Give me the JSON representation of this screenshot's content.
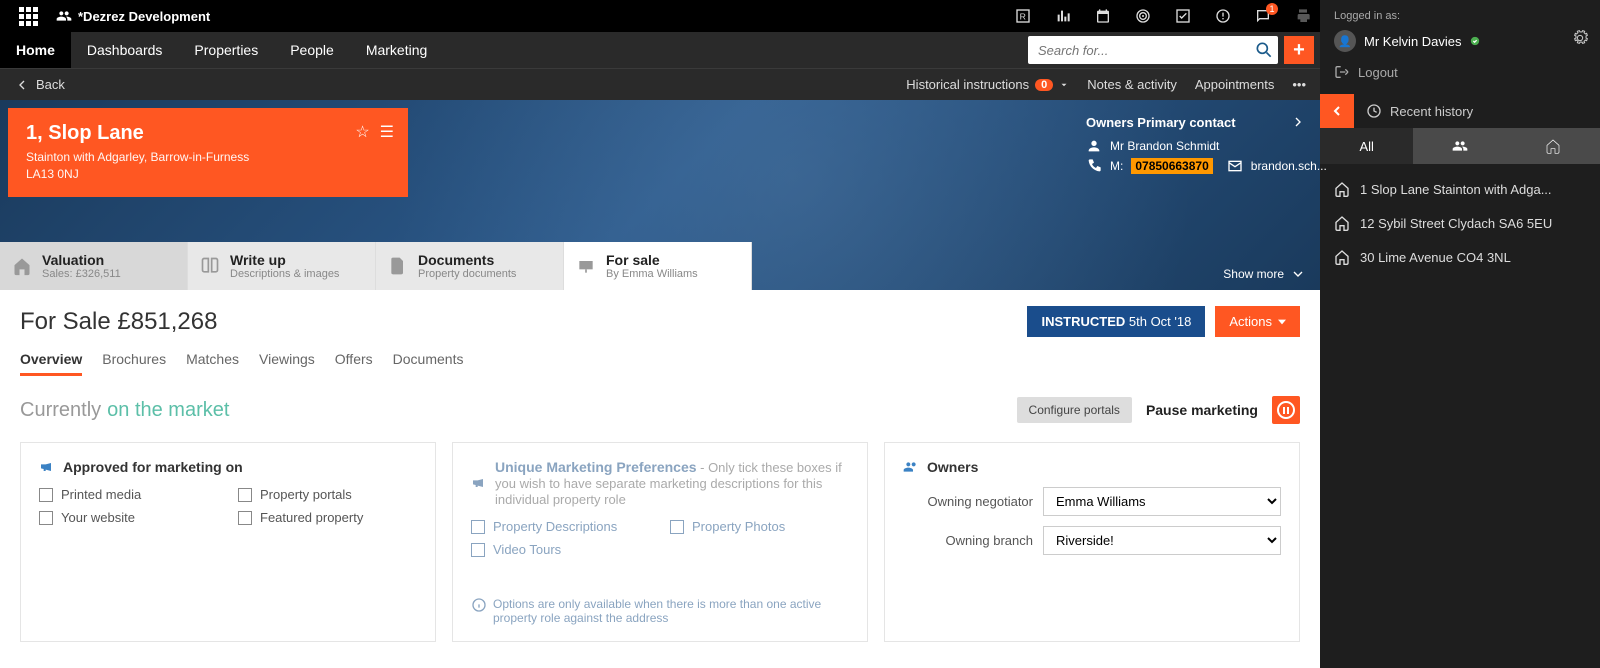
{
  "brand": "*Dezrez Development",
  "nav": {
    "home": "Home",
    "dashboards": "Dashboards",
    "properties": "Properties",
    "people": "People",
    "marketing": "Marketing"
  },
  "search": {
    "placeholder": "Search for..."
  },
  "topIcons": {
    "chatBadge": "1"
  },
  "subbar": {
    "back": "Back",
    "historical": "Historical instructions",
    "historical_badge": "0",
    "notes": "Notes & activity",
    "appointments": "Appointments"
  },
  "property": {
    "title": "1, Slop Lane",
    "line2": "Stainton with Adgarley, Barrow-in-Furness",
    "line3": "LA13 0NJ"
  },
  "owner": {
    "heading": "Owners Primary contact",
    "name": "Mr Brandon Schmidt",
    "mobile_label": "M:",
    "mobile": "07850663870",
    "email": "brandon.sch..."
  },
  "showMore": "Show more",
  "stages": {
    "valuation": {
      "t": "Valuation",
      "s": "Sales: £326,511"
    },
    "writeup": {
      "t": "Write up",
      "s": "Descriptions & images"
    },
    "documents": {
      "t": "Documents",
      "s": "Property documents"
    },
    "forsale": {
      "t": "For sale",
      "s": "By Emma Williams"
    }
  },
  "page": {
    "title": "For Sale £851,268",
    "instructed_label": "INSTRUCTED",
    "instructed_date": "5th Oct '18",
    "actions": "Actions"
  },
  "subtabs": {
    "overview": "Overview",
    "brochures": "Brochures",
    "matches": "Matches",
    "viewings": "Viewings",
    "offers": "Offers",
    "documents": "Documents"
  },
  "status": {
    "label": "Currently",
    "value": "on the market",
    "configure": "Configure portals",
    "pause": "Pause marketing"
  },
  "card1": {
    "title": "Approved for marketing on",
    "opts": [
      "Printed media",
      "Property portals",
      "Your website",
      "Featured property"
    ]
  },
  "card2": {
    "title": "Unique Marketing Preferences",
    "hint": " - Only tick these boxes if you wish to have separate marketing descriptions for this individual property role",
    "opts": [
      "Property Descriptions",
      "Property Photos",
      "Video Tours"
    ],
    "note": "Options are only available when there is more than one active property role against the address"
  },
  "card3": {
    "title": "Owners",
    "negotiator_label": "Owning negotiator",
    "negotiator_value": "Emma Williams",
    "branch_label": "Owning branch",
    "branch_value": "Riverside!"
  },
  "side": {
    "loggedInAs": "Logged in as:",
    "user": "Mr Kelvin Davies",
    "logout": "Logout",
    "recent": "Recent history",
    "tabAll": "All",
    "items": [
      "1 Slop Lane Stainton with Adga...",
      "12 Sybil Street Clydach SA6 5EU",
      "30 Lime Avenue CO4 3NL"
    ]
  }
}
